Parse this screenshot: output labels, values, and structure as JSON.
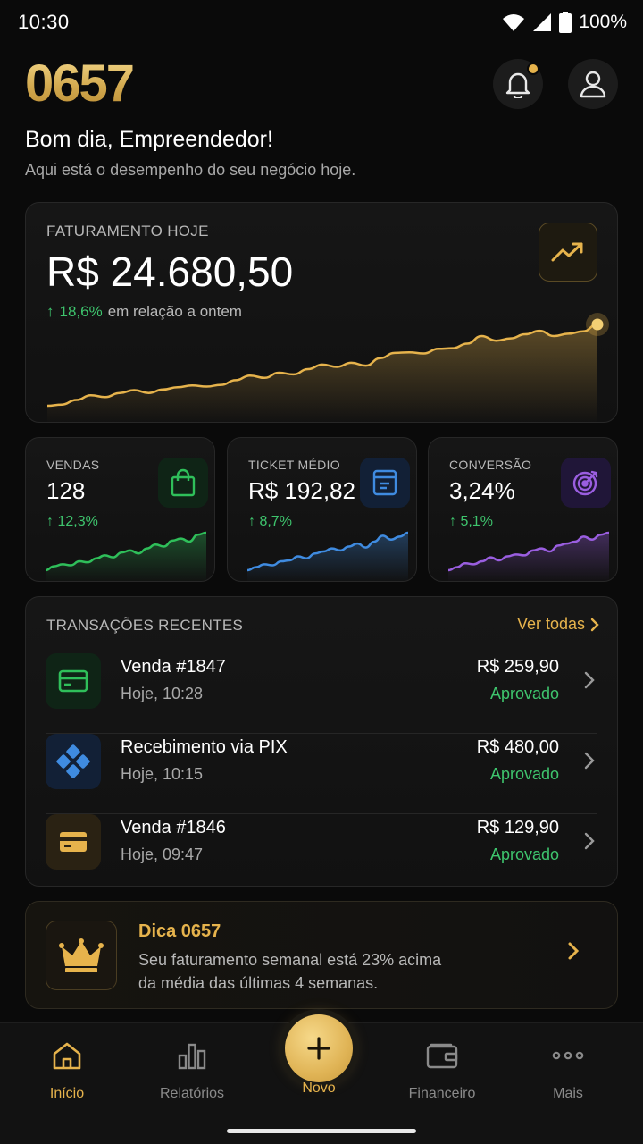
{
  "status_bar": {
    "time": "10:30",
    "battery": "100%"
  },
  "header": {
    "logo": "0657"
  },
  "greeting": {
    "title": "Bom dia, Empreendedor!",
    "subtitle": "Aqui está o desempenho do seu negócio hoje."
  },
  "revenue": {
    "label": "FATURAMENTO HOJE",
    "value": "R$ 24.680,50",
    "change": "18,6%",
    "change_suffix": "em relação a ontem",
    "sparkline": [
      8,
      10,
      18,
      26,
      23,
      30,
      35,
      30,
      36,
      40,
      43,
      41,
      44,
      52,
      60,
      56,
      65,
      62,
      71,
      79,
      75,
      82,
      77,
      90,
      99,
      100,
      98,
      106,
      107,
      115,
      128,
      120,
      124,
      131,
      137,
      128,
      132,
      136,
      148
    ]
  },
  "metrics": [
    {
      "label": "VENDAS",
      "value": "128",
      "change": "12,3%",
      "color": "#2fbf5a",
      "icon": "shopping-bag-icon",
      "sparkline": [
        4,
        8,
        10,
        9,
        13,
        12,
        16,
        19,
        17,
        22,
        24,
        21,
        26,
        30,
        28,
        34,
        36,
        33,
        40,
        42
      ]
    },
    {
      "label": "TICKET MÉDIO",
      "value": "R$ 192,82",
      "change": "8,7%",
      "color": "#3f8be0",
      "icon": "receipt-icon",
      "sparkline": [
        3,
        6,
        9,
        8,
        12,
        13,
        17,
        15,
        20,
        22,
        25,
        23,
        27,
        30,
        26,
        32,
        38,
        34,
        37,
        41
      ]
    },
    {
      "label": "CONVERSÃO",
      "value": "3,24%",
      "change": "5,1%",
      "color": "#9a5ee0",
      "icon": "target-icon",
      "sparkline": [
        2,
        5,
        9,
        8,
        11,
        15,
        12,
        16,
        18,
        17,
        22,
        24,
        21,
        27,
        29,
        31,
        36,
        33,
        38,
        40
      ]
    }
  ],
  "transactions": {
    "title": "TRANSAÇÕES RECENTES",
    "see_all": "Ver todas",
    "items": [
      {
        "name": "Venda #1847",
        "time": "Hoje, 10:28",
        "amount": "R$ 259,90",
        "status": "Aprovado",
        "icon": "credit-card-icon",
        "color": "#2fbf5a"
      },
      {
        "name": "Recebimento via PIX",
        "time": "Hoje, 10:15",
        "amount": "R$ 480,00",
        "status": "Aprovado",
        "icon": "pix-icon",
        "color": "#3f8be0"
      },
      {
        "name": "Venda #1846",
        "time": "Hoje, 09:47",
        "amount": "R$ 129,90",
        "status": "Aprovado",
        "icon": "credit-card-icon",
        "color": "#e6b34c"
      }
    ]
  },
  "tip": {
    "title": "Dica 0657",
    "line1": "Seu faturamento semanal está 23% acima",
    "line2": "da média das últimas 4 semanas."
  },
  "nav": [
    {
      "label": "Início",
      "icon": "home-icon",
      "active": true
    },
    {
      "label": "Relatórios",
      "icon": "bar-chart-icon",
      "active": false
    },
    {
      "label": "Novo",
      "icon": "plus-icon",
      "active": false
    },
    {
      "label": "Financeiro",
      "icon": "wallet-icon",
      "active": false
    },
    {
      "label": "Mais",
      "icon": "more-icon",
      "active": false
    }
  ],
  "colors": {
    "accent": "#e6b34c",
    "positive": "#3ec46d",
    "background": "#0a0a0a"
  }
}
